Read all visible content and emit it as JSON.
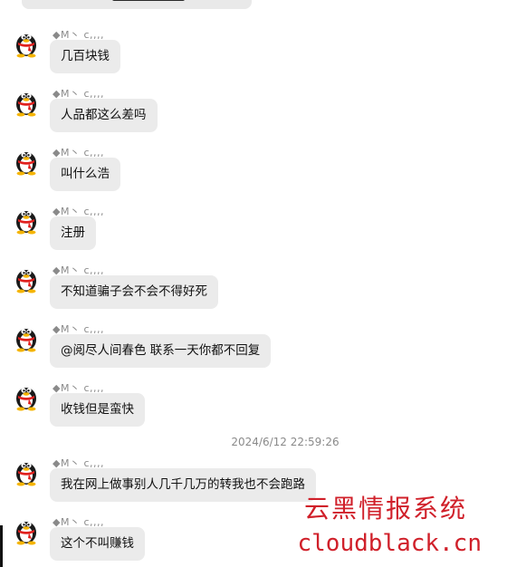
{
  "messages": [
    {
      "sender": "◆M丶 c,,,,",
      "text": "几百块钱",
      "avatar": "qq-penguin-icon"
    },
    {
      "sender": "◆M丶 c,,,,",
      "text": "人品都这么差吗",
      "avatar": "qq-penguin-icon"
    },
    {
      "sender": "◆M丶 c,,,,",
      "text": "叫什么浩",
      "avatar": "qq-penguin-icon"
    },
    {
      "sender": "◆M丶 c,,,,",
      "text": "注册",
      "avatar": "qq-penguin-icon"
    },
    {
      "sender": "◆M丶 c,,,,",
      "text": "不知道骗子会不会不得好死",
      "avatar": "qq-penguin-icon"
    },
    {
      "sender": "◆M丶 c,,,,",
      "text": "@阅尽人间春色 联系一天你都不回复",
      "avatar": "qq-penguin-icon"
    },
    {
      "sender": "◆M丶 c,,,,",
      "text": "收钱但是蛮快",
      "avatar": "qq-penguin-icon"
    },
    {
      "sender": "◆M丶 c,,,,",
      "text": "我在网上做事别人几千几万的转我也不会跑路",
      "avatar": "qq-penguin-icon"
    },
    {
      "sender": "◆M丶 c,,,,",
      "text": "这个不叫赚钱",
      "avatar": "qq-penguin-icon"
    }
  ],
  "timestamp": "2024/6/12 22:59:26",
  "watermark": {
    "title": "云黑情报系统",
    "url": "cloudblack.cn",
    "color": "#d0202a"
  },
  "colors": {
    "bubble": "#ebebeb",
    "sender": "#8a8a8a"
  }
}
